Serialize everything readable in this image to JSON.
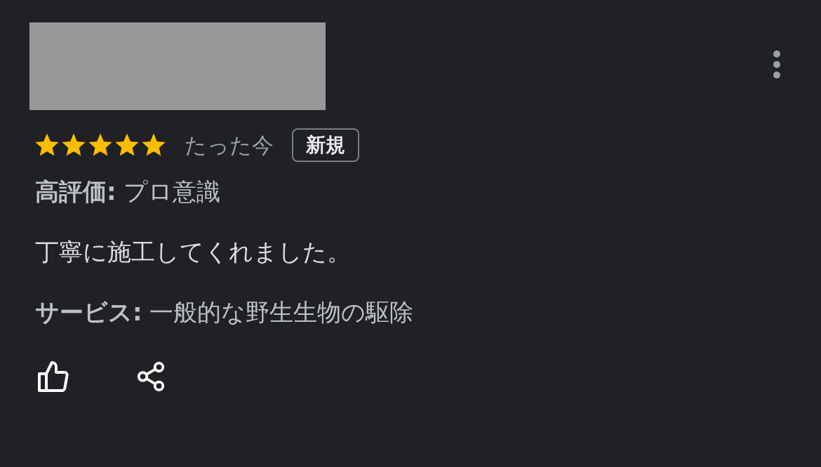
{
  "review": {
    "stars": 5,
    "time": "たった今",
    "badge": "新規",
    "positive": "**高評価:** プロ意識",
    "text": "丁寧に施工してくれました。",
    "service": "**サービス:** 一般的な野生生物の駆除"
  }
}
